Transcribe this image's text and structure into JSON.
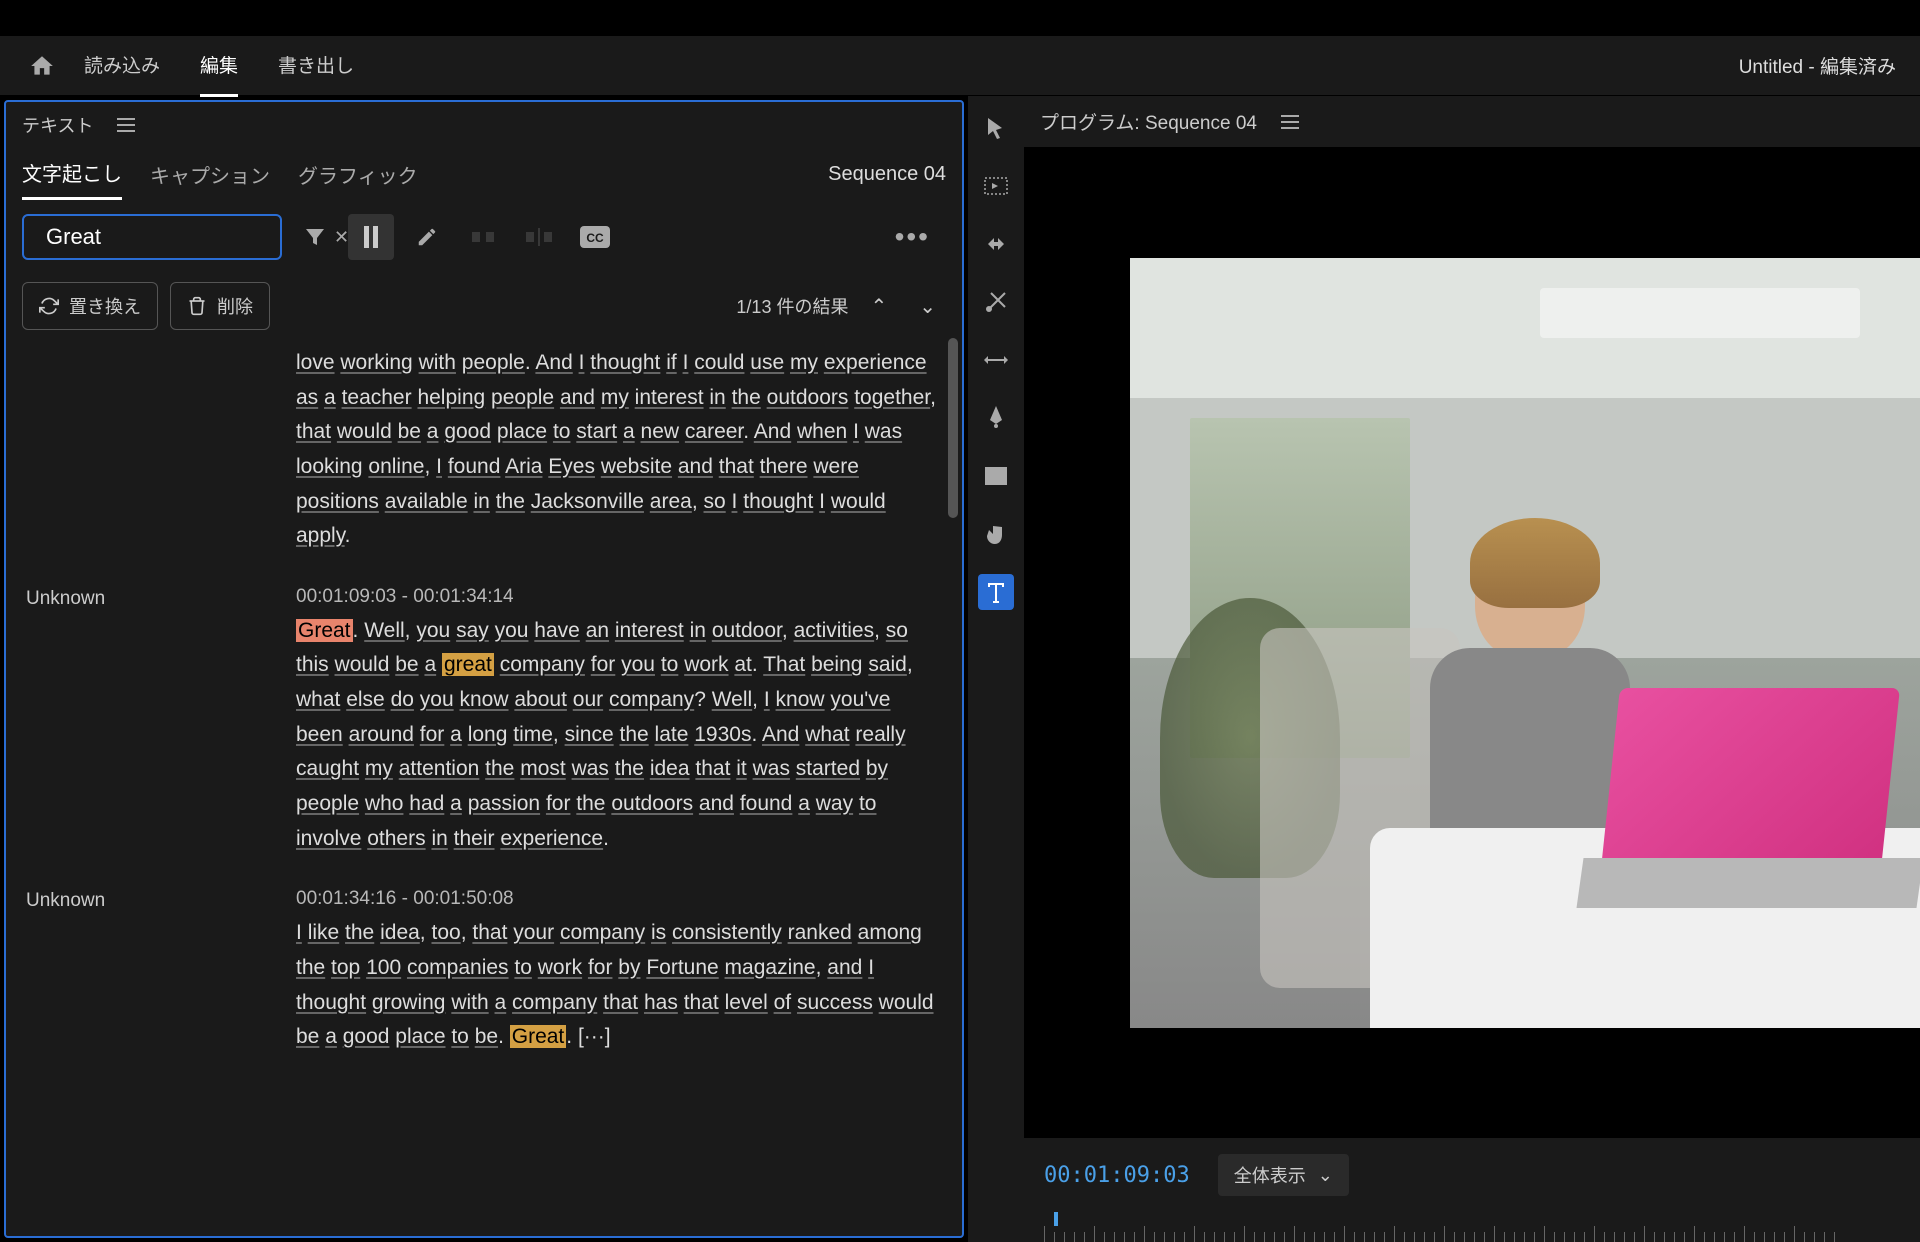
{
  "nav": {
    "import": "読み込み",
    "edit": "編集",
    "export": "書き出し",
    "title": "Untitled - 編集済み"
  },
  "textPanel": {
    "label": "テキスト",
    "tabs": {
      "transcript": "文字起こし",
      "caption": "キャプション",
      "graphic": "グラフィック"
    },
    "sequence": "Sequence 04",
    "search": {
      "value": "Great"
    },
    "actions": {
      "replace": "置き換え",
      "delete": "削除"
    },
    "results": "1/13 件の結果"
  },
  "segments": [
    {
      "speaker": "",
      "time": "",
      "pre": "",
      "text": "love working with people. And I thought if I could use my experience as a teacher helping people and my interest in the outdoors together, that would be a good place to start a new career. And when I was looking online, I found Aria Eyes website and that there were positions available in the Jacksonville area, so I thought I would apply."
    },
    {
      "speaker": "Unknown",
      "time": "00:01:09:03 - 00:01:34:14",
      "text": "Great. Well, you say you have an interest in outdoor, activities, so this would be a great company for you to work at. That being said, what else do you know about our company? Well, I know you've been around for a long time, since the late 1930s. And what really caught my attention the most was the idea that it was started by people who had a passion for the outdoors and found a way to involve others in their experience."
    },
    {
      "speaker": "Unknown",
      "time": "00:01:34:16 - 00:01:50:08",
      "text": "I like the idea, too, that your company is consistently ranked among the top 100 companies to work for by Fortune magazine, and I thought growing with a company that has that level of success would be a good place to be. Great. [···]"
    }
  ],
  "program": {
    "label": "プログラム: Sequence 04",
    "timecode": "00:01:09:03",
    "viewMode": "全体表示"
  },
  "highlight": "Great",
  "highlightLower": "great"
}
